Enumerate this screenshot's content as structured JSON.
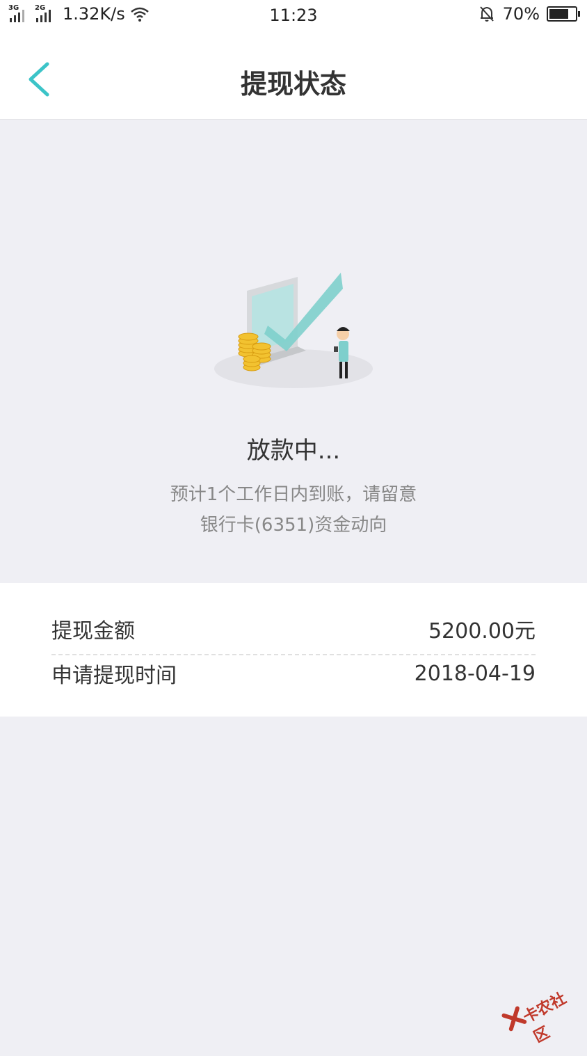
{
  "statusbar": {
    "net1": "3G",
    "net2": "2G",
    "speed": "1.32K/s",
    "time": "11:23",
    "battery": "70%",
    "battery_level": 0.7
  },
  "header": {
    "title": "提现状态"
  },
  "status": {
    "title": "放款中...",
    "desc_line1": "预计1个工作日内到账，请留意",
    "desc_line2": "银行卡(6351)资金动向"
  },
  "details": [
    {
      "label": "提现金额",
      "value": "5200.00元"
    },
    {
      "label": "申请提现时间",
      "value": "2018-04-19"
    }
  ],
  "watermark": {
    "text": "卡农社区"
  },
  "colors": {
    "accent": "#3cc4c8",
    "background": "#efeff4",
    "coin": "#f2c230"
  }
}
